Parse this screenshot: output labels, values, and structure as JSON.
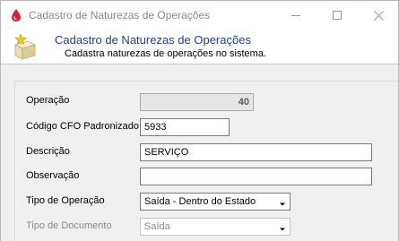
{
  "window": {
    "title": "Cadastro de Naturezas de Operações"
  },
  "header": {
    "title": "Cadastro de Naturezas de Operações",
    "subtitle": "Cadastra naturezas de operações no sistema."
  },
  "form": {
    "operacao": {
      "label": "Operação",
      "value": "40"
    },
    "cfo": {
      "label": "Código CFO Padronizado",
      "value": "5933"
    },
    "descricao": {
      "label": "Descrição",
      "value": "SERVIÇO"
    },
    "observacao": {
      "label": "Observação",
      "value": ""
    },
    "tipo_operacao": {
      "label": "Tipo de Operação",
      "selected": "Saída - Dentro do Estado"
    },
    "tipo_documento": {
      "label": "Tipo de Documento",
      "selected": "Saída"
    }
  },
  "colors": {
    "header_title": "#1f3f94",
    "app_icon": "#d6232a",
    "disabled_text": "#8a8a8a"
  },
  "icons": {
    "app": "red-drop-icon",
    "header": "box-star-icon",
    "minimize": "minimize-icon",
    "maximize": "maximize-icon",
    "close": "close-icon",
    "dropdown": "chevron-down-icon"
  }
}
